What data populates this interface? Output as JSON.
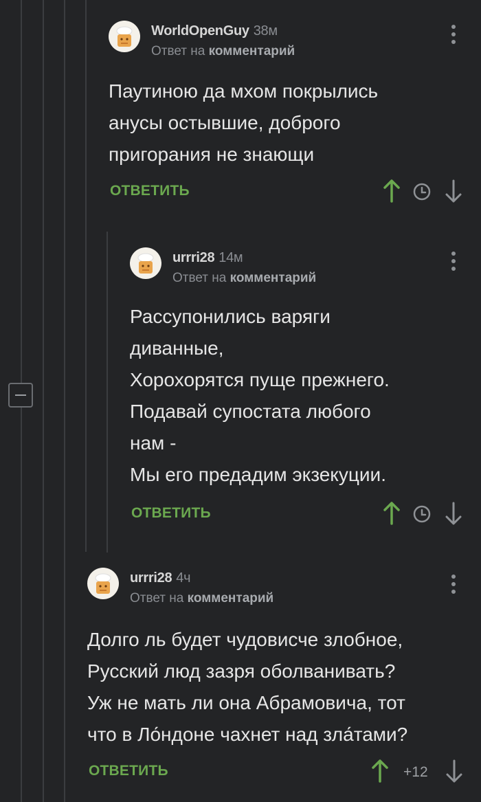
{
  "colors": {
    "background": "#232426",
    "accent_green": "#6ba84f",
    "muted": "#8a8d92"
  },
  "comments": [
    {
      "username": "WorldOpenGuy",
      "time": "38м",
      "reply_prefix": "Ответ на",
      "reply_link": "комментарий",
      "lines": [
        "Паутиною да мхом покрылись",
        "анусы остывшие, доброго",
        "пригорания не знающи"
      ],
      "reply_label": "ОТВЕТИТЬ"
    },
    {
      "username": "urrri28",
      "time": "14м",
      "reply_prefix": "Ответ на",
      "reply_link": "комментарий",
      "lines": [
        "Рассупонились варяги",
        "диванные,",
        "Хорохорятся пуще прежнего.",
        "Подавай супостата любого",
        "нам -",
        "Мы его предадим экзекуции."
      ],
      "reply_label": "ОТВЕТИТЬ"
    },
    {
      "username": "urrri28",
      "time": "4ч",
      "reply_prefix": "Ответ на",
      "reply_link": "комментарий",
      "lines": [
        "Долго ль будет чудовисче злобное,",
        "Русский люд зазря оболванивать?",
        "Уж не мать ли она Абрамовича, тот",
        "что в Ло́ндоне чахнет над зла́тами?"
      ],
      "reply_label": "ОТВЕТИТЬ",
      "score": "+12"
    }
  ],
  "icons": [
    "avatar-chef-icon",
    "kebab-menu-icon",
    "upvote-arrow-icon",
    "clock-icon",
    "downvote-arrow-icon",
    "collapse-minus-icon"
  ]
}
